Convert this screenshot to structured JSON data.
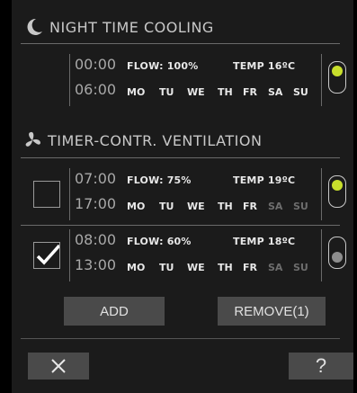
{
  "night_cooling": {
    "title": "NIGHT TIME COOLING",
    "icon": "moon-icon",
    "start": "00:00",
    "end": "06:00",
    "flow": "FLOW: 100%",
    "temp": "TEMP 16ºC",
    "days": [
      "MO",
      "TU",
      "WE",
      "TH",
      "FR",
      "SA",
      "SU"
    ],
    "days_active": [
      true,
      true,
      true,
      true,
      true,
      true,
      true
    ],
    "enabled": true
  },
  "timer_ventilation": {
    "title": "TIMER-CONTR. VENTILATION",
    "icon": "fan-icon",
    "entries": [
      {
        "start": "07:00",
        "end": "17:00",
        "flow": "FLOW: 75%",
        "temp": "TEMP 19ºC",
        "days": [
          "MO",
          "TU",
          "WE",
          "TH",
          "FR",
          "SA",
          "SU"
        ],
        "days_active": [
          true,
          true,
          true,
          true,
          true,
          false,
          false
        ],
        "selected": false,
        "enabled": true
      },
      {
        "start": "08:00",
        "end": "13:00",
        "flow": "FLOW: 60%",
        "temp": "TEMP 18ºC",
        "days": [
          "MO",
          "TU",
          "WE",
          "TH",
          "FR",
          "SA",
          "SU"
        ],
        "days_active": [
          true,
          true,
          true,
          true,
          true,
          false,
          false
        ],
        "selected": true,
        "enabled": false
      }
    ]
  },
  "actions": {
    "add_label": "ADD",
    "remove_label": "REMOVE(1)"
  },
  "footer": {
    "close_icon": "close-icon",
    "help_label": "?"
  },
  "colors": {
    "toggle_on": "#c8df2c",
    "toggle_off": "#8e8e8e",
    "panel_bg": "#1b1b1b"
  }
}
